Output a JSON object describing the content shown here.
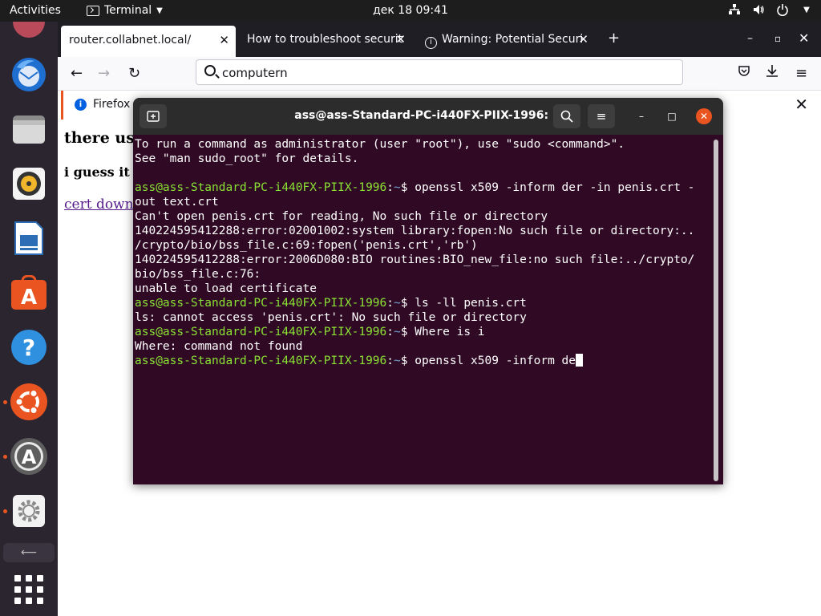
{
  "topbar": {
    "activities": "Activities",
    "app_name": "Terminal",
    "clock": "дек 18  09:41"
  },
  "dock": {
    "items": [
      "Firefox",
      "Thunderbird",
      "Files",
      "Rhythmbox",
      "LibreOffice Impress",
      "Ubuntu Software",
      "Help",
      "Ubuntu",
      "Updater",
      "Settings"
    ]
  },
  "firefox": {
    "tabs": [
      {
        "label": "router.collabnet.local/",
        "active": true
      },
      {
        "label": "How to troubleshoot securit",
        "active": false
      },
      {
        "label": "Warning: Potential Securi",
        "active": false
      }
    ],
    "url_value": "computern",
    "notification": "Firefox",
    "page": {
      "heading": "there us",
      "subheading": "i guess it",
      "link": "cert downl"
    }
  },
  "terminal": {
    "title": "ass@ass-Standard-PC-i440FX-PIIX-1996: ~",
    "prompt_user": "ass@ass-Standard-PC-i440FX-PIIX-1996",
    "prompt_sep": ":",
    "prompt_path": "~",
    "prompt_end": "$ ",
    "lines": [
      {
        "type": "out",
        "text": "To run a command as administrator (user \"root\"), use \"sudo <command>\"."
      },
      {
        "type": "out",
        "text": "See \"man sudo_root\" for details."
      },
      {
        "type": "out",
        "text": ""
      },
      {
        "type": "cmd",
        "text": "openssl x509 -inform der -in penis.crt -"
      },
      {
        "type": "out",
        "text": "out text.crt"
      },
      {
        "type": "out",
        "text": "Can't open penis.crt for reading, No such file or directory"
      },
      {
        "type": "out",
        "text": "140224595412288:error:02001002:system library:fopen:No such file or directory:.."
      },
      {
        "type": "out",
        "text": "/crypto/bio/bss_file.c:69:fopen('penis.crt','rb')"
      },
      {
        "type": "out",
        "text": "140224595412288:error:2006D080:BIO routines:BIO_new_file:no such file:../crypto/"
      },
      {
        "type": "out",
        "text": "bio/bss_file.c:76:"
      },
      {
        "type": "out",
        "text": "unable to load certificate"
      },
      {
        "type": "cmd",
        "text": "ls -ll penis.crt"
      },
      {
        "type": "out",
        "text": "ls: cannot access 'penis.crt': No such file or directory"
      },
      {
        "type": "cmd",
        "text": "Where is i"
      },
      {
        "type": "out",
        "text": "Where: command not found"
      },
      {
        "type": "cmd",
        "text": "openssl x509 -inform de",
        "cursor": true
      }
    ]
  },
  "colors": {
    "terminal_bg": "#300a24",
    "prompt_user": "#8ae234",
    "prompt_path": "#729fcf",
    "ubuntu_orange": "#e95420"
  }
}
